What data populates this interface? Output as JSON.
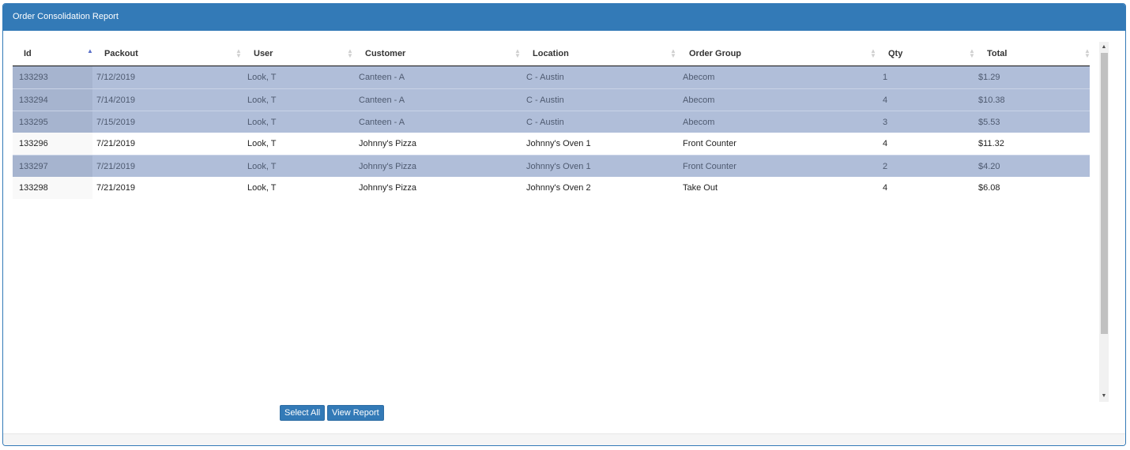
{
  "panel": {
    "title": "Order Consolidation Report"
  },
  "table": {
    "columns": {
      "id": "Id",
      "packout": "Packout",
      "user": "User",
      "customer": "Customer",
      "location": "Location",
      "order_group": "Order Group",
      "qty": "Qty",
      "total": "Total"
    },
    "sort": {
      "column": "id",
      "direction": "ascending"
    },
    "rows": [
      {
        "id": "133293",
        "packout": "7/12/2019",
        "user": "Look, T",
        "customer": "Canteen - A",
        "location": "C - Austin",
        "order_group": "Abecom",
        "qty": "1",
        "total": "$1.29",
        "selected": true
      },
      {
        "id": "133294",
        "packout": "7/14/2019",
        "user": "Look, T",
        "customer": "Canteen - A",
        "location": "C - Austin",
        "order_group": "Abecom",
        "qty": "4",
        "total": "$10.38",
        "selected": true
      },
      {
        "id": "133295",
        "packout": "7/15/2019",
        "user": "Look, T",
        "customer": "Canteen - A",
        "location": "C - Austin",
        "order_group": "Abecom",
        "qty": "3",
        "total": "$5.53",
        "selected": true
      },
      {
        "id": "133296",
        "packout": "7/21/2019",
        "user": "Look, T",
        "customer": "Johnny's Pizza",
        "location": "Johnny's Oven 1",
        "order_group": "Front Counter",
        "qty": "4",
        "total": "$11.32",
        "selected": false
      },
      {
        "id": "133297",
        "packout": "7/21/2019",
        "user": "Look, T",
        "customer": "Johnny's Pizza",
        "location": "Johnny's Oven 1",
        "order_group": "Front Counter",
        "qty": "2",
        "total": "$4.20",
        "selected": true
      },
      {
        "id": "133298",
        "packout": "7/21/2019",
        "user": "Look, T",
        "customer": "Johnny's Pizza",
        "location": "Johnny's Oven 2",
        "order_group": "Take Out",
        "qty": "4",
        "total": "$6.08",
        "selected": false
      }
    ]
  },
  "buttons": {
    "select_all": "Select All",
    "view_report": "View Report"
  },
  "icons": {
    "sort_ascending": "sort-ascending-icon",
    "sort_neutral": "sort-both-icon",
    "scroll_up": "scroll-up-arrow-icon",
    "scroll_down": "scroll-down-arrow-icon"
  },
  "colors": {
    "primary": "#337ab7",
    "selected_row": "#b0bed9",
    "sort_active": "#5a6fc8"
  }
}
